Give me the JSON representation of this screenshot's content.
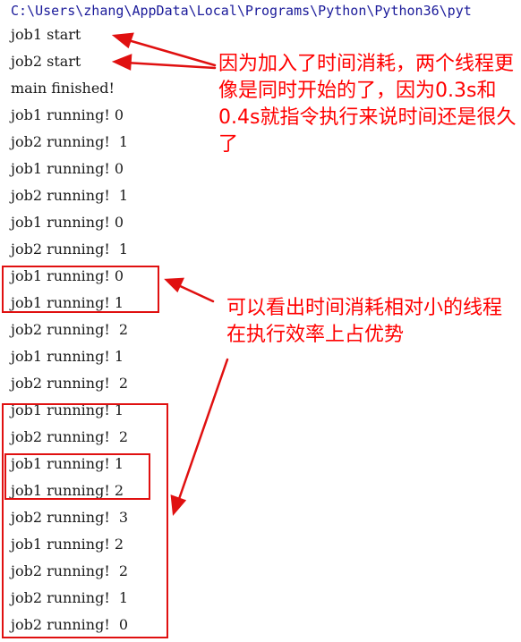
{
  "header": {
    "path": "C:\\Users\\zhang\\AppData\\Local\\Programs\\Python\\Python36\\pyt"
  },
  "console": {
    "lines": [
      "job1 start",
      "job2 start",
      "main finished!",
      "job1 running! 0",
      "job2 running!  1",
      "job1 running! 0",
      "job2 running!  1",
      "job1 running! 0",
      "job2 running!  1",
      "job1 running! 0",
      "job1 running! 1",
      "job2 running!  2",
      "job1 running! 1",
      "job2 running!  2",
      "job1 running! 1",
      "job2 running!  2",
      "job1 running! 1",
      "job1 running! 2",
      "job2 running!  3",
      "job1 running! 2",
      "job2 running!  2",
      "job2 running!  1",
      "job2 running!  0"
    ]
  },
  "annotations": {
    "note1": "因为加入了时间消耗，两个线程更像是同时开始的了，因为0.3s和0.4s就指令执行来说时间还是很久了",
    "note2": "可以看出时间消耗相对小的线程在执行效率上占优势"
  },
  "colors": {
    "annotation": "#ff0000",
    "header_text": "#1b1b9a",
    "console_text": "#1a1a1a"
  }
}
